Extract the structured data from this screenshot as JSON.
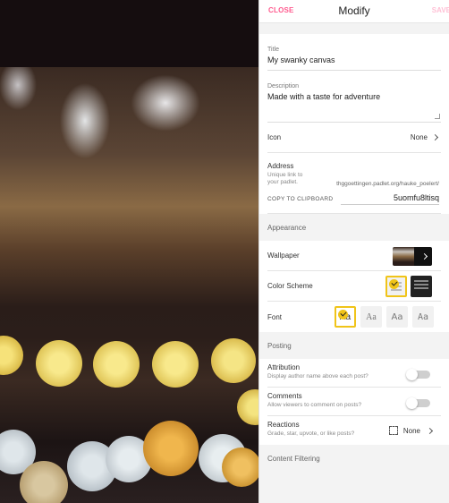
{
  "header": {
    "close_label": "CLOSE",
    "title": "Modify",
    "save_label": "SAVE"
  },
  "fields": {
    "title_label": "Title",
    "title_value": "My swanky canvas",
    "description_label": "Description",
    "description_value": "Made with a taste for adventure"
  },
  "icon_row": {
    "label": "Icon",
    "value": "None"
  },
  "address": {
    "label": "Address",
    "help": "Unique link to your padlet.",
    "url_prefix": "thggoettingen.padlet.org/hauke_poelert/",
    "copy_label": "COPY TO CLIPBOARD",
    "slug": "5uomfu8ltisq"
  },
  "appearance": {
    "heading": "Appearance",
    "wallpaper_label": "Wallpaper",
    "color_scheme_label": "Color Scheme",
    "font_label": "Font",
    "font_sample": "Aa"
  },
  "posting": {
    "heading": "Posting",
    "attribution_label": "Attribution",
    "attribution_help": "Display author name above each post?",
    "comments_label": "Comments",
    "comments_help": "Allow viewers to comment on posts?",
    "reactions_label": "Reactions",
    "reactions_help": "Grade, star, upvote, or like posts?",
    "reactions_value": "None"
  },
  "content_filtering": {
    "heading": "Content Filtering"
  },
  "colors": {
    "accent": "#ff5b8f",
    "selection": "#f0c419"
  }
}
